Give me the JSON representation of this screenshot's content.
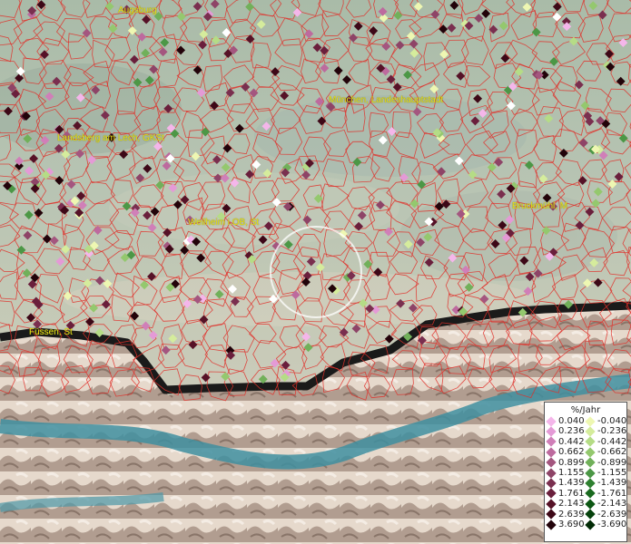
{
  "cities": [
    {
      "name": "Augsburg"
    },
    {
      "name": "München, Landeshauptstadt"
    },
    {
      "name": "Landsberg am Lech, GKSt"
    },
    {
      "name": "Weilheim i.OB, St"
    },
    {
      "name": "Bruckmühl, M"
    },
    {
      "name": "Füssen, St"
    }
  ],
  "legend": {
    "title": "%/Jahr",
    "positive": [
      {
        "label": "0.040",
        "color": "#f4b6ea"
      },
      {
        "label": "0.236",
        "color": "#e49ad6"
      },
      {
        "label": "0.442",
        "color": "#d07fb8"
      },
      {
        "label": "0.662",
        "color": "#bd6a9e"
      },
      {
        "label": "0.899",
        "color": "#a4567f"
      },
      {
        "label": "1.155",
        "color": "#8e4467"
      },
      {
        "label": "1.439",
        "color": "#7a2f4f"
      },
      {
        "label": "1.761",
        "color": "#6a1f3c"
      },
      {
        "label": "2.143",
        "color": "#561227"
      },
      {
        "label": "2.639",
        "color": "#3d0817"
      },
      {
        "label": "3.690",
        "color": "#22030a"
      }
    ],
    "negative": [
      {
        "label": "-0.040",
        "color": "#eef7b2"
      },
      {
        "label": "-0.236",
        "color": "#d5ec9c"
      },
      {
        "label": "-0.442",
        "color": "#b5dc86"
      },
      {
        "label": "-0.662",
        "color": "#94c86e"
      },
      {
        "label": "-0.899",
        "color": "#71b05a"
      },
      {
        "label": "-1.155",
        "color": "#4c9746"
      },
      {
        "label": "-1.439",
        "color": "#2f8030"
      },
      {
        "label": "-1.761",
        "color": "#1a6a1f"
      },
      {
        "label": "-2.143",
        "color": "#0d5714"
      },
      {
        "label": "-2.639",
        "color": "#06420c"
      },
      {
        "label": "-3.690",
        "color": "#022b06"
      }
    ]
  }
}
